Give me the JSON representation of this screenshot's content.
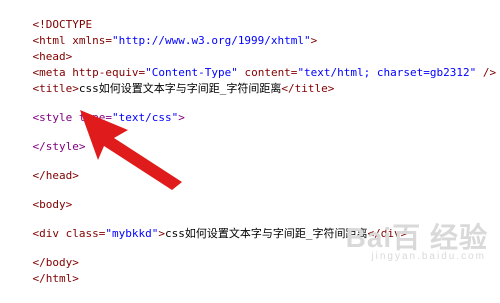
{
  "code": {
    "doctype": "<!DOCTYPE",
    "html_open_prefix": "<html",
    "html_xmlns_attr": " xmlns=",
    "html_xmlns_val": "\"http://www.w3.org/1999/xhtml\"",
    "html_open_suffix": ">",
    "head_open": "<head>",
    "meta_prefix": "<meta",
    "meta_http_attr": " http-equiv=",
    "meta_http_val": "\"Content-Type\"",
    "meta_content_attr": " content=",
    "meta_content_val": "\"text/html; charset=gb2312\"",
    "meta_suffix": " />",
    "title_open": "<title>",
    "title_text": "css如何设置文本字与字间距_字符间距离",
    "title_close": "</title>",
    "style_open_prefix": "<style",
    "style_type_attr": " type=",
    "style_type_val": "\"text/css\"",
    "style_open_suffix": ">",
    "style_close": "</style>",
    "head_close": "</head>",
    "body_open": "<body>",
    "div_prefix": "<div",
    "div_class_attr": " class=",
    "div_class_val": "\"mybkkd\"",
    "div_suffix": ">",
    "div_text": "css如何设置文本字与字间距_字符间距离",
    "div_close": "</div>",
    "body_close": "</body>",
    "html_close": "</html>"
  },
  "watermark": {
    "logo": "Bai百 经验",
    "subtext": "jingyan.baidu.com"
  },
  "colors": {
    "tag": "#800000",
    "style_tag": "#800080",
    "value": "#0000ff",
    "arrow": "#e01b1b"
  },
  "icons": {
    "arrow": "red-arrow-pointer-icon"
  }
}
